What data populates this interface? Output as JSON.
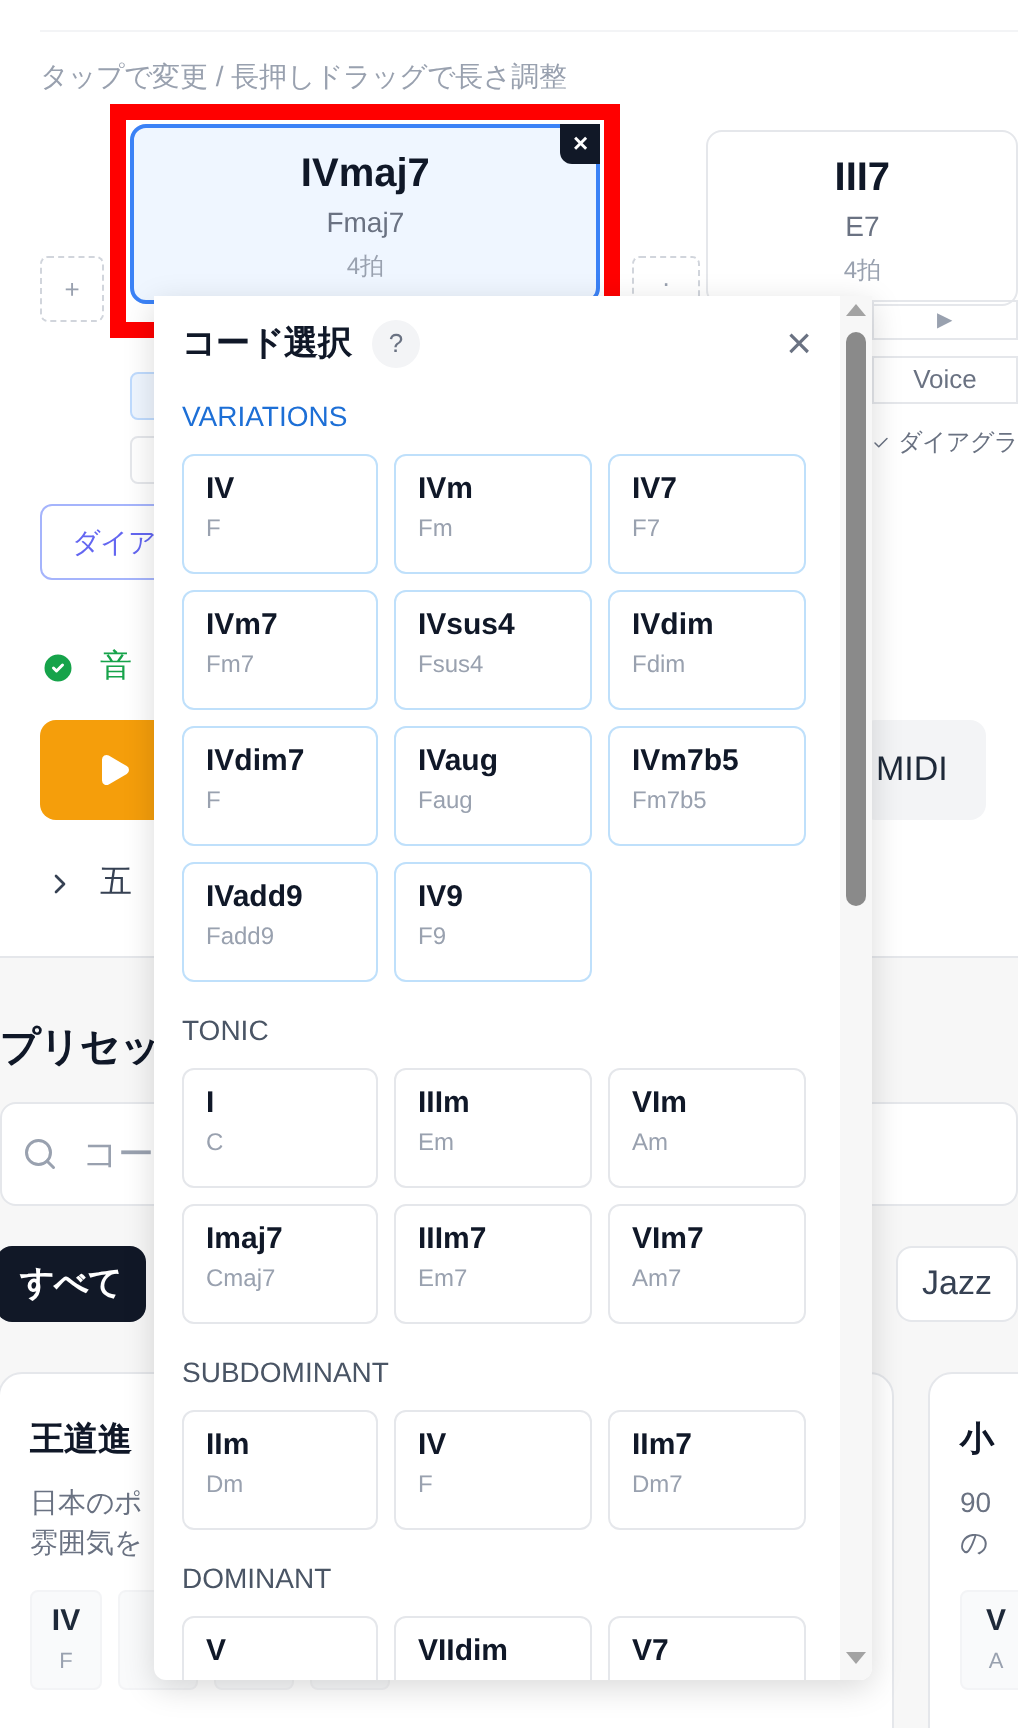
{
  "hint": "タップで変更 / 長押しドラッグで長さ調整",
  "timeline": {
    "chords": [
      {
        "numeral": "IVmaj7",
        "name": "Fmaj7",
        "beats": "4拍",
        "selected": true,
        "remove": "×"
      },
      {
        "numeral": "III7",
        "name": "E7",
        "beats": "4拍",
        "selected": false
      }
    ],
    "add_slots": [
      "+",
      "."
    ]
  },
  "side_controls": {
    "play": "▶",
    "voice": "Voice",
    "diagram": {
      "label": "ダイアグラ",
      "checked": true
    }
  },
  "diagram_button": "ダイア",
  "status": {
    "text": "音",
    "ok": true
  },
  "midi_button": "MIDI",
  "circle_toggle": {
    "label": "五",
    "expanded": false
  },
  "presets": {
    "title": "プリセッ",
    "search_placeholder": "コー",
    "filters": [
      {
        "label": "すべて",
        "selected": true
      },
      {
        "label": "Jazz",
        "selected": false
      }
    ],
    "cards": [
      {
        "title": "王道進",
        "description": [
          "日本のポ",
          "雰囲気を"
        ],
        "chords": [
          {
            "numeral": "IV",
            "name": "F"
          }
        ]
      },
      {
        "title": "小",
        "description": [
          "90",
          "の"
        ],
        "chords": [
          {
            "numeral": "V",
            "name": "A"
          }
        ]
      }
    ]
  },
  "popup": {
    "title": "コード選択",
    "help": "?",
    "close": "×",
    "sections": [
      {
        "title": "VARIATIONS",
        "highlighted": true,
        "chords": [
          {
            "numeral": "IV",
            "name": "F"
          },
          {
            "numeral": "IVm",
            "name": "Fm"
          },
          {
            "numeral": "IV7",
            "name": "F7"
          },
          {
            "numeral": "IVm7",
            "name": "Fm7"
          },
          {
            "numeral": "IVsus4",
            "name": "Fsus4"
          },
          {
            "numeral": "IVdim",
            "name": "Fdim"
          },
          {
            "numeral": "IVdim7",
            "name": "F"
          },
          {
            "numeral": "IVaug",
            "name": "Faug"
          },
          {
            "numeral": "IVm7b5",
            "name": "Fm7b5"
          },
          {
            "numeral": "IVadd9",
            "name": "Fadd9"
          },
          {
            "numeral": "IV9",
            "name": "F9"
          }
        ]
      },
      {
        "title": "TONIC",
        "highlighted": false,
        "chords": [
          {
            "numeral": "I",
            "name": "C"
          },
          {
            "numeral": "IIIm",
            "name": "Em"
          },
          {
            "numeral": "VIm",
            "name": "Am"
          },
          {
            "numeral": "Imaj7",
            "name": "Cmaj7"
          },
          {
            "numeral": "IIIm7",
            "name": "Em7"
          },
          {
            "numeral": "VIm7",
            "name": "Am7"
          }
        ]
      },
      {
        "title": "SUBDOMINANT",
        "highlighted": false,
        "chords": [
          {
            "numeral": "IIm",
            "name": "Dm"
          },
          {
            "numeral": "IV",
            "name": "F"
          },
          {
            "numeral": "IIm7",
            "name": "Dm7"
          }
        ]
      },
      {
        "title": "DOMINANT",
        "highlighted": false,
        "chords": [
          {
            "numeral": "V"
          },
          {
            "numeral": "VIIdim"
          },
          {
            "numeral": "V7"
          }
        ]
      }
    ]
  }
}
